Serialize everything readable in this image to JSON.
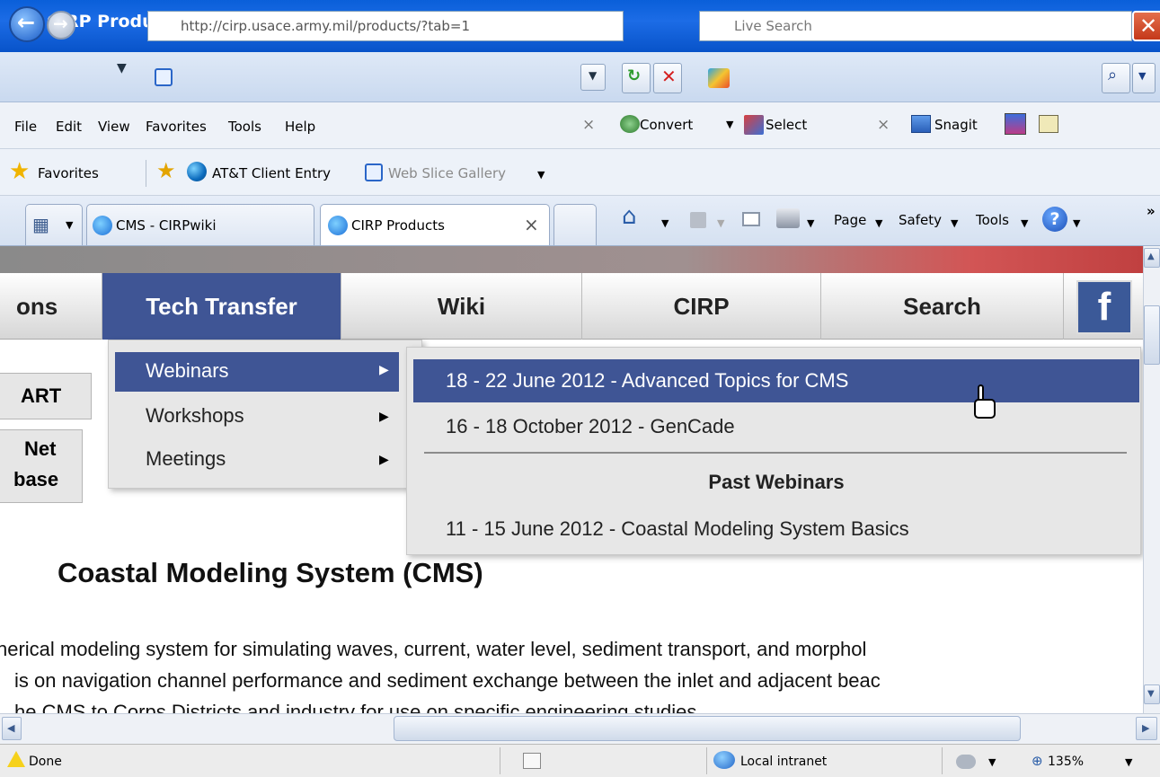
{
  "window": {
    "title": "CIRP Products - Windows Internet Explorer"
  },
  "address_bar": {
    "url": "http://cirp.usace.army.mil/products/?tab=1"
  },
  "search": {
    "placeholder": "Live Search"
  },
  "menu": {
    "items": [
      "File",
      "Edit",
      "View",
      "Favorites",
      "Tools",
      "Help"
    ]
  },
  "toolbar_right": {
    "convert": "Convert",
    "select": "Select",
    "snagit": "Snagit"
  },
  "favorites": {
    "label": "Favorites",
    "links": [
      "AT&T Client Entry",
      "Web Slice Gallery"
    ]
  },
  "tabs": [
    {
      "label": "CMS - CIRPwiki"
    },
    {
      "label": "CIRP Products"
    }
  ],
  "command_bar": {
    "page": "Page",
    "safety": "Safety",
    "tools": "Tools",
    "more": "»"
  },
  "site_nav": {
    "items": [
      "ons",
      "Tech Transfer",
      "Wiki",
      "CIRP",
      "Search"
    ],
    "facebook": "f"
  },
  "left_stubs": [
    "ART",
    "Net",
    "base"
  ],
  "dropdown": {
    "items": [
      "Webinars",
      "Workshops",
      "Meetings"
    ]
  },
  "submenu": {
    "items": [
      "18 - 22 June 2012 - Advanced Topics for CMS",
      "16 - 18 October 2012 - GenCade"
    ],
    "section_title": "Past Webinars",
    "past_items": [
      "11 - 15 June 2012 - Coastal Modeling System Basics"
    ]
  },
  "content": {
    "heading": "Coastal Modeling System (CMS)",
    "lines": [
      "nerical modeling system for simulating waves, current, water level, sediment transport, and morphol",
      "is on navigation channel performance and sediment exchange between the inlet and adjacent beac",
      "he CMS to Corps Districts and industry for use on specific engineering studies"
    ]
  },
  "status": {
    "text": "Done",
    "zone": "Local intranet",
    "zoom": "135%"
  },
  "colors": {
    "titlebar": "#0a5fd9",
    "nav_active": "#3f5595",
    "menu_highlight": "#3f5595"
  }
}
